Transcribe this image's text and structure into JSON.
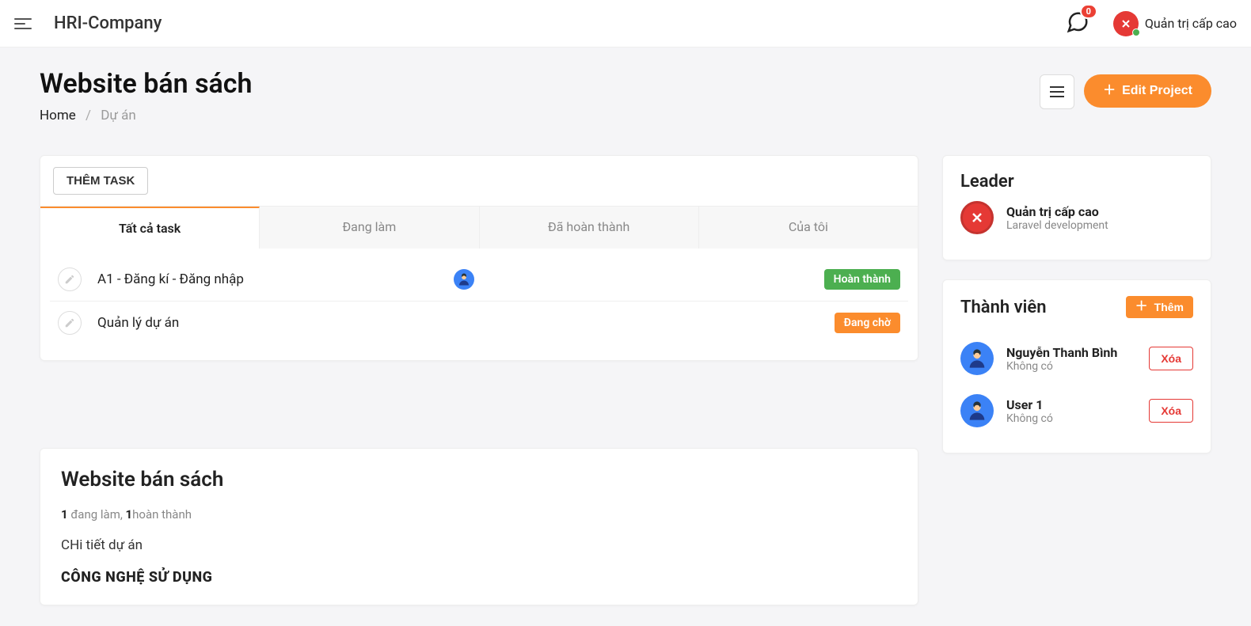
{
  "topbar": {
    "brand": "HRI-Company",
    "chat_badge": "0",
    "user_role": "Quản trị cấp cao"
  },
  "page": {
    "title": "Website bán sách",
    "breadcrumb_home": "Home",
    "breadcrumb_current": "Dự án",
    "edit_project_label": "Edit Project",
    "add_task_label": "THÊM TASK"
  },
  "tabs": [
    {
      "label": "Tất cả task",
      "active": true
    },
    {
      "label": "Đang làm",
      "active": false
    },
    {
      "label": "Đã hoàn thành",
      "active": false
    },
    {
      "label": "Của tôi",
      "active": false
    }
  ],
  "tasks": [
    {
      "title": "A1 - Đăng kí - Đăng nhập",
      "status_label": "Hoàn thành",
      "status_class": "status-green",
      "has_avatar": true
    },
    {
      "title": "Quản lý dự án",
      "status_label": "Đang chờ",
      "status_class": "status-orange",
      "has_avatar": false
    }
  ],
  "detail": {
    "title": "Website bán sách",
    "doing_count": "1",
    "doing_label": "đang làm",
    "done_count": "1",
    "done_label": "hoàn thành",
    "sep": ", ",
    "text": "CHi tiết dự án",
    "tech_heading": "CÔNG NGHỆ SỬ DỤNG"
  },
  "leader": {
    "heading": "Leader",
    "name": "Quản trị cấp cao",
    "sub": "Laravel development"
  },
  "members": {
    "heading": "Thành viên",
    "add_label": "Thêm",
    "delete_label": "Xóa",
    "list": [
      {
        "name": "Nguyễn Thanh Bình",
        "sub": "Không có"
      },
      {
        "name": "User 1",
        "sub": "Không có"
      }
    ]
  }
}
